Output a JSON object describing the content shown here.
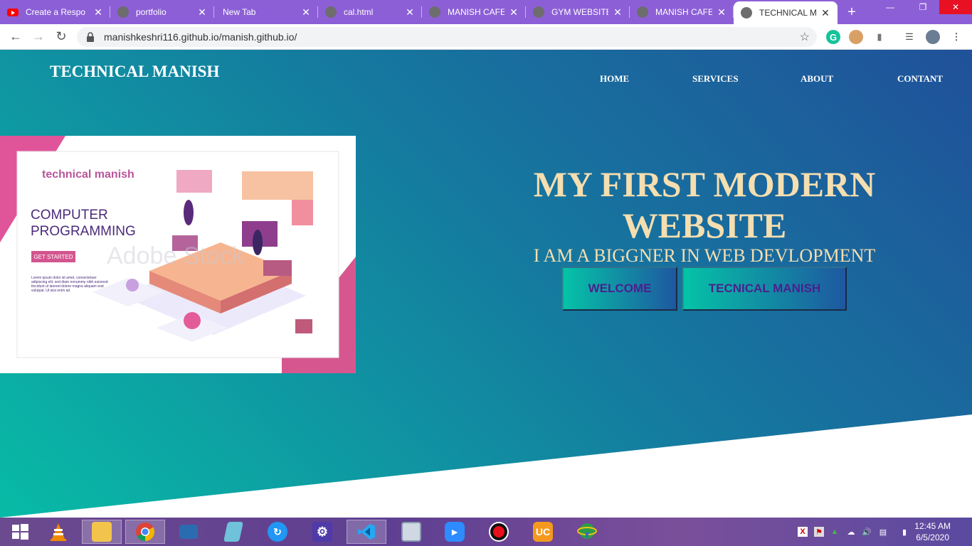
{
  "browser": {
    "tabs": [
      {
        "title": "Create a Respo",
        "icon": "youtube-icon",
        "color": "#ff0000"
      },
      {
        "title": "portfolio",
        "icon": "globe-icon",
        "color": "#6d6d6d"
      },
      {
        "title": "New Tab",
        "icon": "",
        "color": ""
      },
      {
        "title": "cal.html",
        "icon": "globe-icon",
        "color": "#6d6d6d"
      },
      {
        "title": "MANISH CAFE",
        "icon": "globe-icon",
        "color": "#6d6d6d"
      },
      {
        "title": "GYM WEBSITE",
        "icon": "globe-icon",
        "color": "#6d6d6d"
      },
      {
        "title": "MANISH CAFE",
        "icon": "globe-icon",
        "color": "#6d6d6d"
      },
      {
        "title": "TECHNICAL MA",
        "icon": "globe-icon",
        "color": "#6d6d6d",
        "active": true
      }
    ],
    "new_tab_label": "+",
    "url": "manishkeshri116.github.io/manish.github.io/",
    "tab_close": "✕"
  },
  "site": {
    "brand": "TECHNICAL MANISH",
    "nav": [
      "HOME",
      "SERVICES",
      "ABOUT",
      "CONTANT"
    ],
    "hero_title": "MY FIRST MODERN WEBSITE",
    "hero_subtitle": "I AM A BIGGNER IN WEB DEVLOPMENT",
    "buttons": [
      "WELCOME",
      "TECNICAL MANISH"
    ],
    "hero_image": {
      "heading": "technical manish",
      "title_line1": "COMPUTER",
      "title_line2": "PROGRAMMING",
      "cta": "GET STARTED",
      "body": "Lorem ipsum dolor sit amet, consectetuer adipiscing elit, sed diam nonummy nibh euismod tincidunt ut laoreet dolore magna aliquam erat volutpat. Ut wisi enim ad",
      "watermark": "Adobe Stock"
    },
    "colors": {
      "gradient_start": "#08bba6",
      "gradient_end": "#20519a",
      "hero_text": "#f5deaf",
      "button_text": "#4b1f8e"
    }
  },
  "taskbar": {
    "apps": [
      "windows-start-icon",
      "vlc-icon",
      "file-explorer-icon",
      "chrome-icon",
      "keyboard-app-icon",
      "notes-app-icon",
      "sync-app-icon",
      "settings-icon",
      "vscode-icon",
      "monitor-app-icon",
      "zoom-icon",
      "recorder-icon",
      "uc-browser-icon",
      "idm-icon"
    ],
    "time": "12:45 AM",
    "date": "6/5/2020"
  }
}
